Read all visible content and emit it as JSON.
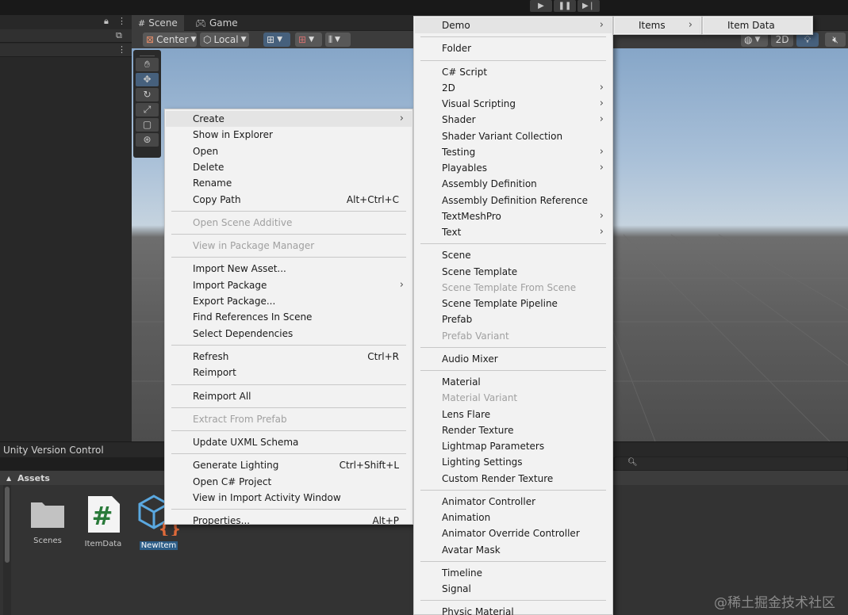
{
  "toolbar": {
    "play_icon": "play-icon",
    "pause_icon": "pause-icon",
    "step_icon": "step-icon"
  },
  "scene_tabs": [
    {
      "label": "Scene",
      "icon": "grid-icon"
    },
    {
      "label": "Game",
      "icon": "gamepad-icon"
    }
  ],
  "scene_toolbar": {
    "pivot": "Center",
    "space": "Local",
    "mode_2d": "2D"
  },
  "bottom_panel": {
    "title": "Unity Version Control",
    "assets_header": "Assets",
    "assets": [
      {
        "label": "Scenes",
        "icon": "folder-icon"
      },
      {
        "label": "ItemData",
        "icon": "csharp-script-icon"
      },
      {
        "label": "NewItem",
        "icon": "scriptable-object-icon",
        "selected": true
      }
    ]
  },
  "context_menu": {
    "groups": [
      [
        {
          "label": "Create",
          "submenu": true,
          "highlighted": true
        },
        {
          "label": "Show in Explorer"
        },
        {
          "label": "Open"
        },
        {
          "label": "Delete"
        },
        {
          "label": "Rename"
        },
        {
          "label": "Copy Path",
          "shortcut": "Alt+Ctrl+C"
        }
      ],
      [
        {
          "label": "Open Scene Additive",
          "disabled": true
        }
      ],
      [
        {
          "label": "View in Package Manager",
          "disabled": true
        }
      ],
      [
        {
          "label": "Import New Asset..."
        },
        {
          "label": "Import Package",
          "submenu": true
        },
        {
          "label": "Export Package..."
        },
        {
          "label": "Find References In Scene"
        },
        {
          "label": "Select Dependencies"
        }
      ],
      [
        {
          "label": "Refresh",
          "shortcut": "Ctrl+R"
        },
        {
          "label": "Reimport"
        }
      ],
      [
        {
          "label": "Reimport All"
        }
      ],
      [
        {
          "label": "Extract From Prefab",
          "disabled": true
        }
      ],
      [
        {
          "label": "Update UXML Schema"
        }
      ],
      [
        {
          "label": "Generate Lighting",
          "shortcut": "Ctrl+Shift+L"
        },
        {
          "label": "Open C# Project"
        },
        {
          "label": "View in Import Activity Window"
        }
      ],
      [
        {
          "label": "Properties...",
          "shortcut": "Alt+P"
        }
      ]
    ]
  },
  "create_menu": {
    "groups": [
      [
        {
          "label": "Demo",
          "submenu": true,
          "highlighted": true
        }
      ],
      [
        {
          "label": "Folder"
        }
      ],
      [
        {
          "label": "C# Script"
        },
        {
          "label": "2D",
          "submenu": true
        },
        {
          "label": "Visual Scripting",
          "submenu": true
        },
        {
          "label": "Shader",
          "submenu": true
        },
        {
          "label": "Shader Variant Collection"
        },
        {
          "label": "Testing",
          "submenu": true
        },
        {
          "label": "Playables",
          "submenu": true
        },
        {
          "label": "Assembly Definition"
        },
        {
          "label": "Assembly Definition Reference"
        },
        {
          "label": "TextMeshPro",
          "submenu": true
        },
        {
          "label": "Text",
          "submenu": true
        }
      ],
      [
        {
          "label": "Scene"
        },
        {
          "label": "Scene Template"
        },
        {
          "label": "Scene Template From Scene",
          "disabled": true
        },
        {
          "label": "Scene Template Pipeline"
        },
        {
          "label": "Prefab"
        },
        {
          "label": "Prefab Variant",
          "disabled": true
        }
      ],
      [
        {
          "label": "Audio Mixer"
        }
      ],
      [
        {
          "label": "Material"
        },
        {
          "label": "Material Variant",
          "disabled": true
        },
        {
          "label": "Lens Flare"
        },
        {
          "label": "Render Texture"
        },
        {
          "label": "Lightmap Parameters"
        },
        {
          "label": "Lighting Settings"
        },
        {
          "label": "Custom Render Texture"
        }
      ],
      [
        {
          "label": "Animator Controller"
        },
        {
          "label": "Animation"
        },
        {
          "label": "Animator Override Controller"
        },
        {
          "label": "Avatar Mask"
        }
      ],
      [
        {
          "label": "Timeline"
        },
        {
          "label": "Signal"
        }
      ],
      [
        {
          "label": "Physic Material"
        }
      ]
    ]
  },
  "demo_menu": {
    "items": [
      {
        "label": "Items",
        "submenu": true,
        "highlighted": true
      }
    ]
  },
  "items_menu": {
    "items": [
      {
        "label": "Item Data",
        "highlighted": true
      }
    ]
  },
  "watermark": "@稀土掘金技术社区"
}
